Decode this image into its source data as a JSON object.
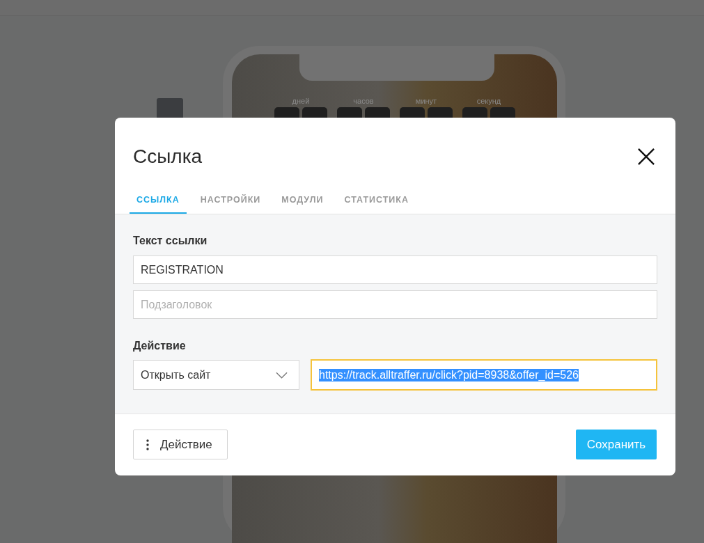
{
  "background": {
    "countdown_labels": [
      "дней",
      "часов",
      "минут",
      "секунд"
    ]
  },
  "dialog": {
    "title": "Ссылка",
    "tabs": [
      {
        "label": "ССЫЛКА",
        "selected": true
      },
      {
        "label": "НАСТРОЙКИ",
        "selected": false
      },
      {
        "label": "МОДУЛИ",
        "selected": false
      },
      {
        "label": "СТАТИСТИКА",
        "selected": false
      }
    ],
    "link_text_label": "Текст ссылки",
    "link_text_field": {
      "value": "REGISTRATION"
    },
    "subtitle_field": {
      "placeholder": "Подзаголовок"
    },
    "action_label": "Действие",
    "action_select": {
      "value": "Открыть сайт"
    },
    "url_field": {
      "value": "https://track.alltraffer.ru/click?pid=8938&offer_id=526",
      "focused": true,
      "text_selected": true
    },
    "action_button": "Действие",
    "save_button": "Сохранить"
  }
}
